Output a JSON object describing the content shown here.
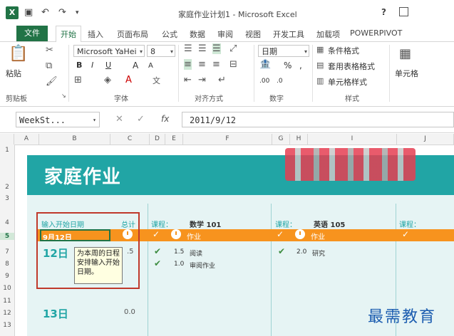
{
  "titlebar": {
    "title": "家庭作业计划1 - Microsoft Excel",
    "help": "?"
  },
  "tabs": [
    "文件",
    "开始",
    "插入",
    "页面布局",
    "公式",
    "数据",
    "审阅",
    "视图",
    "开发工具",
    "加载项",
    "POWERPIVOT"
  ],
  "ribbon": {
    "paste": "粘贴",
    "font_name": "Microsoft YaHei",
    "font_size": "8",
    "number_format": "日期",
    "bold": "B",
    "italic": "I",
    "underline": "U",
    "font_grow": "A",
    "font_shrink": "A",
    "percent": "%",
    "comma": ",",
    "dec_inc": ".00",
    "dec_dec": ".0",
    "cond_format": "条件格式",
    "table_format": "套用表格格式",
    "cell_style": "单元格样式",
    "cells": "单元格",
    "groups": [
      "剪贴板",
      "字体",
      "对齐方式",
      "数字",
      "样式"
    ]
  },
  "formula_bar": {
    "name_box": "WeekSt...",
    "fx": "fx",
    "value": "2011/9/12"
  },
  "columns": [
    "A",
    "B",
    "C",
    "D",
    "E",
    "F",
    "G",
    "H",
    "I",
    "J"
  ],
  "rows": [
    "1",
    "2",
    "3",
    "4",
    "5",
    "7",
    "8",
    "9",
    "10",
    "11",
    "12",
    "13"
  ],
  "sheet": {
    "banner_title": "家庭作业",
    "start_date_label": "输入开始日期",
    "total_label": "总计",
    "course1_label": "课程：",
    "course1_name": "数学 101",
    "course2_label": "课程：",
    "course2_name": "英语 105",
    "course3_label": "课程：",
    "selected_date": "9月12日",
    "homework1": "作业",
    "homework2": "作业",
    "day1": "12日",
    "day1_total": ".5",
    "day2": "13日",
    "day2_total": "0.0",
    "task1_hours": "1.5",
    "task1_name": "阅读",
    "task2_hours": "1.0",
    "task2_name": "审阅作业",
    "task3_hours": "2.0",
    "task3_name": "研究"
  },
  "tooltip": "为本周的日程安排输入开始日期。",
  "watermark": "最需教育"
}
